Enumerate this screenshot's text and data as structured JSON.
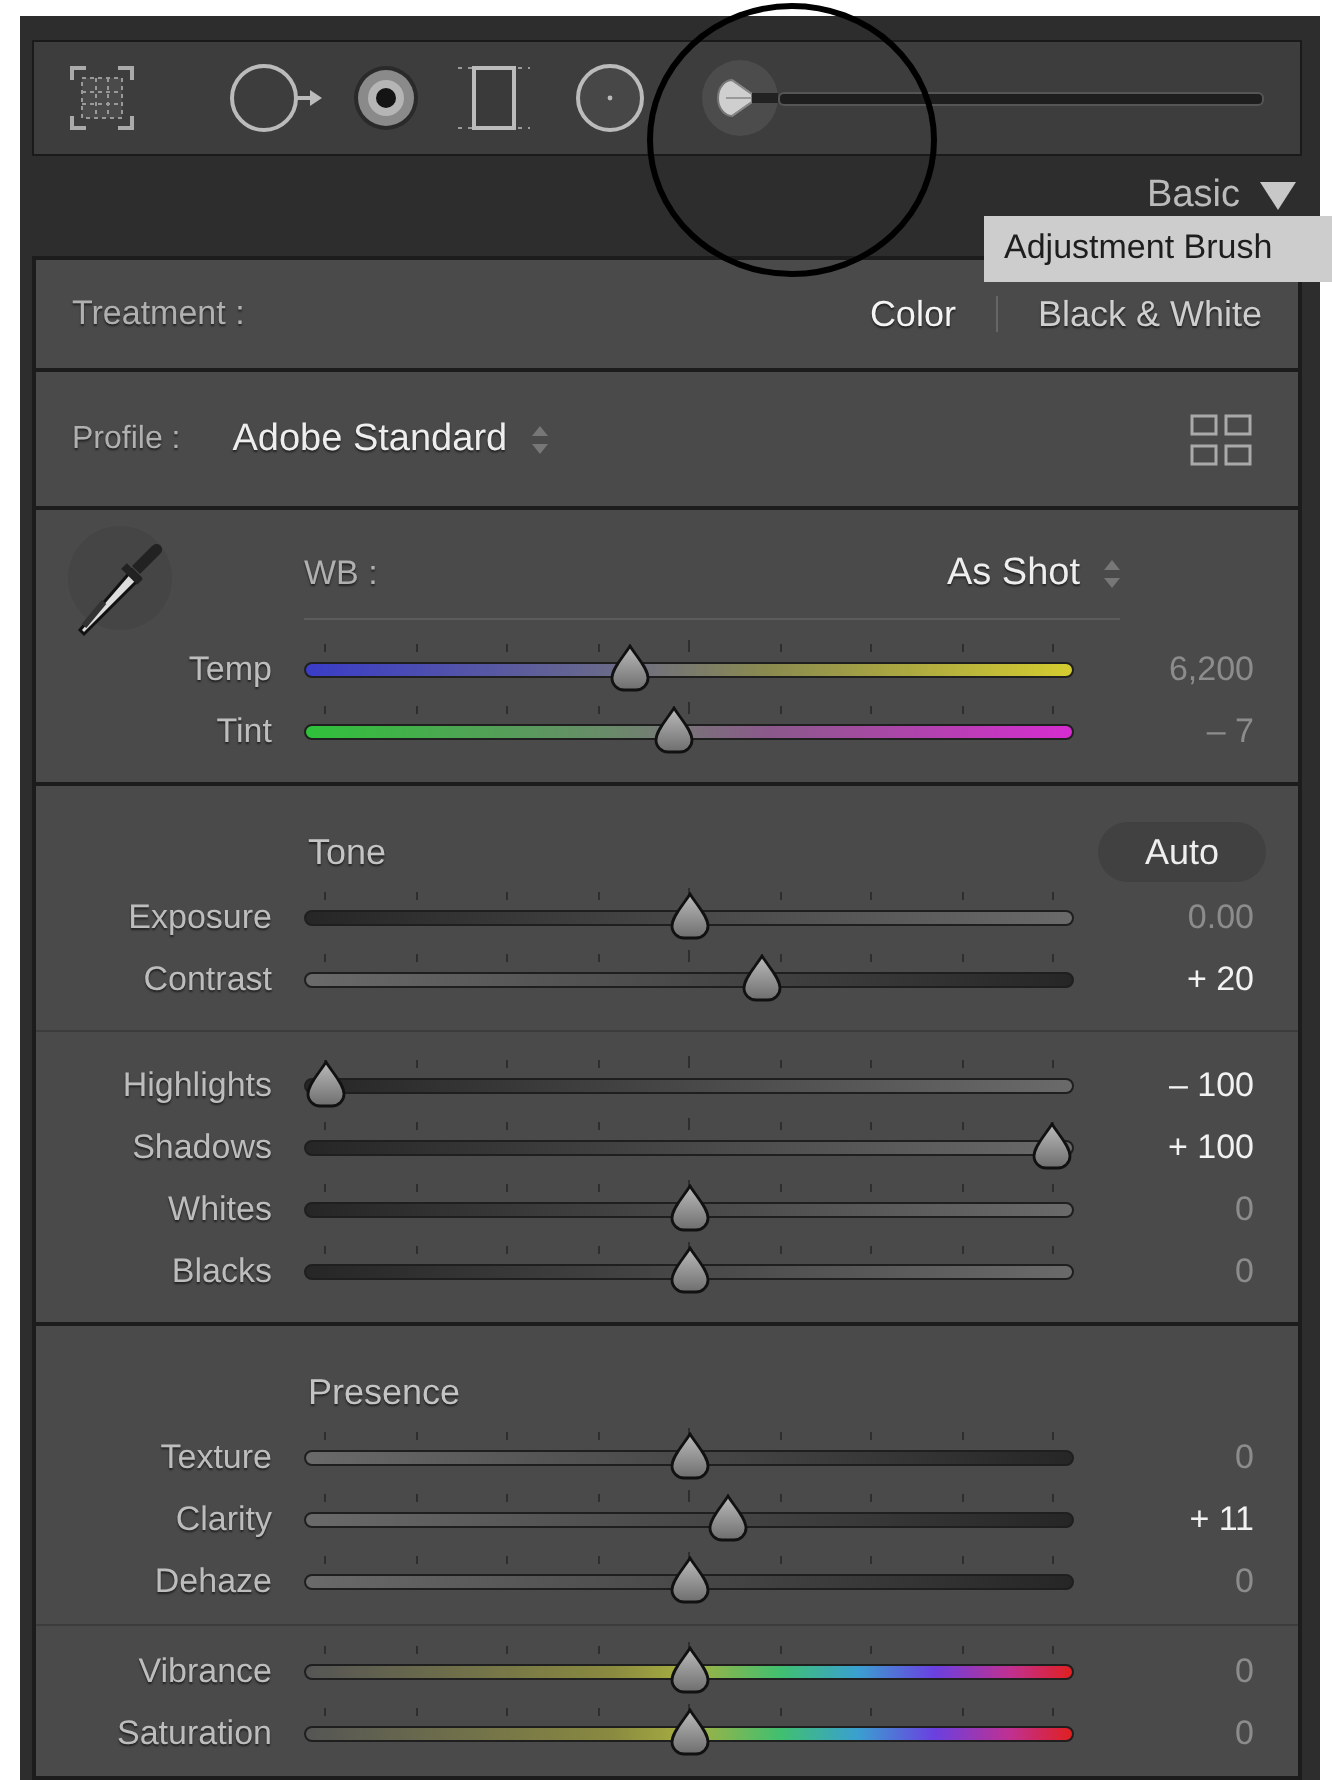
{
  "tools": [
    {
      "kind": "crop",
      "selected": false
    },
    {
      "kind": "spot",
      "selected": false
    },
    {
      "kind": "redeye",
      "selected": false
    },
    {
      "kind": "graduated",
      "selected": false
    },
    {
      "kind": "radial",
      "selected": false
    },
    {
      "kind": "brush",
      "selected": true
    }
  ],
  "panel_header": {
    "title": "Basic"
  },
  "tooltip": "Adjustment Brush",
  "treatment": {
    "label": "Treatment :",
    "options": [
      {
        "label": "Color",
        "selected": true
      },
      {
        "label": "Black & White",
        "selected": false
      }
    ]
  },
  "profile": {
    "label": "Profile :",
    "value": "Adobe Standard"
  },
  "white_balance": {
    "label": "WB :",
    "value": "As Shot",
    "sliders": [
      {
        "label": "Temp",
        "kind": "temp",
        "level": 0.42,
        "value": "6,200",
        "edited": false
      },
      {
        "label": "Tint",
        "kind": "tint",
        "level": 0.48,
        "value": "– 7",
        "edited": false
      }
    ]
  },
  "tone": {
    "title": "Tone",
    "auto_button": "Auto",
    "groups": [
      {
        "sliders": [
          {
            "label": "Exposure",
            "kind": "dark-light",
            "level": 0.5,
            "value": "0.00",
            "edited": false
          },
          {
            "label": "Contrast",
            "kind": "light-dark",
            "level": 0.6,
            "value": "+ 20",
            "edited": true
          }
        ]
      },
      {
        "sliders": [
          {
            "label": "Highlights",
            "kind": "dark-light",
            "level": 0,
            "value": "– 100",
            "edited": true
          },
          {
            "label": "Shadows",
            "kind": "dark-light",
            "level": 1,
            "value": "+ 100",
            "edited": true
          },
          {
            "label": "Whites",
            "kind": "dark-light",
            "level": 0.5,
            "value": "0",
            "edited": false
          },
          {
            "label": "Blacks",
            "kind": "dark-light",
            "level": 0.5,
            "value": "0",
            "edited": false
          }
        ]
      }
    ]
  },
  "presence": {
    "title": "Presence",
    "groups": [
      {
        "sliders": [
          {
            "label": "Texture",
            "kind": "light-dark",
            "level": 0.5,
            "value": "0",
            "edited": false
          },
          {
            "label": "Clarity",
            "kind": "light-dark",
            "level": 0.555,
            "value": "+ 11",
            "edited": true
          },
          {
            "label": "Dehaze",
            "kind": "light-dark",
            "level": 0.5,
            "value": "0",
            "edited": false
          }
        ]
      },
      {
        "sliders": [
          {
            "label": "Vibrance",
            "kind": "spectrum",
            "level": 0.5,
            "value": "0",
            "edited": false
          },
          {
            "label": "Saturation",
            "kind": "spectrum",
            "level": 0.5,
            "value": "0",
            "edited": false
          }
        ]
      }
    ]
  }
}
